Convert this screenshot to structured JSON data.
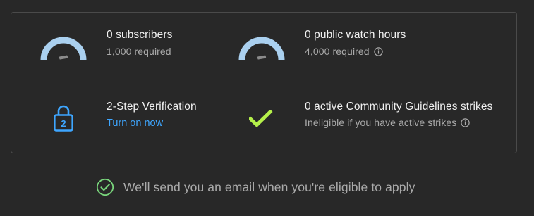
{
  "requirements": [
    {
      "title": "0 subscribers",
      "subtitle": "1,000 required",
      "icon": "gauge-icon",
      "progress": 0
    },
    {
      "title": "0 public watch hours",
      "subtitle": "4,000 required",
      "icon": "gauge-icon",
      "info_icon": "info-icon",
      "progress": 0
    },
    {
      "title": "2-Step Verification",
      "link": "Turn on now",
      "icon": "lock-icon",
      "icon_label": "2"
    },
    {
      "title": "0 active Community Guidelines strikes",
      "subtitle": "Ineligible if you have active strikes",
      "icon": "checkmark-icon",
      "info_icon": "info-icon"
    }
  ],
  "footer": {
    "text": "We'll send you an email when you're eligible to apply",
    "icon": "check-circle-icon"
  },
  "colors": {
    "background": "#282828",
    "title": "#f1f1f1",
    "subtitle": "#aaaaaa",
    "link": "#3ea6ff",
    "gauge": "#aad0ef",
    "needle": "#8b8b8b",
    "check": "#b5f04a",
    "footer_check": "#7ad77d",
    "lock": "#3ea6ff"
  }
}
